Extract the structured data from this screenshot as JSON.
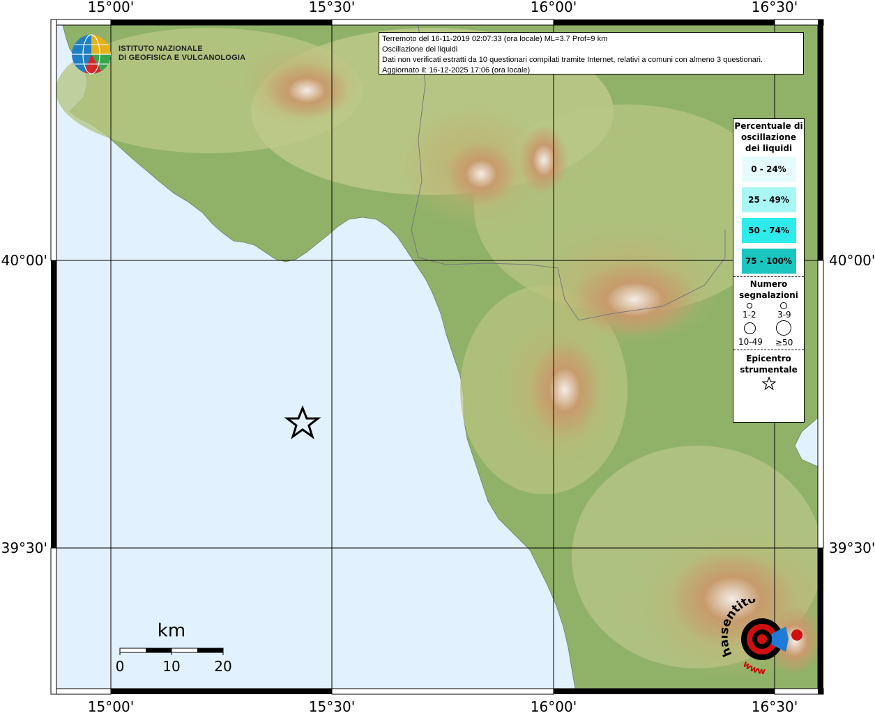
{
  "title_box": {
    "line1": "Terremoto del 16-11-2019 02:07:33 (ora locale) ML=3.7 Prof=9 km",
    "line2": "Oscillazione dei liquidi",
    "line3": "Dati non verificati estratti da 10 questionari compilati tramite Internet, relativi a comuni con almeno 3 questionari.",
    "line4": "Aggiornato il: 16-12-2025 17:06 (ora locale)"
  },
  "logo": {
    "line1": "ISTITUTO NAZIONALE",
    "line2": "DI GEOFISICA E VULCANOLOGIA"
  },
  "axes": {
    "top": [
      "15°00'",
      "15°30'",
      "16°00'",
      "16°30'"
    ],
    "bottom": [
      "15°00'",
      "15°30'",
      "16°00'",
      "16°30'"
    ],
    "left": [
      "40°00'",
      "39°30'"
    ],
    "right": [
      "40°00'",
      "39°30'"
    ]
  },
  "legend": {
    "pct_title": "Percentuale di oscillazione dei liquidi",
    "pct_items": [
      {
        "label": "0 - 24%",
        "color": "#e6fcfc"
      },
      {
        "label": "25 - 49%",
        "color": "#a8f7f5"
      },
      {
        "label": "50 - 74%",
        "color": "#2fecec"
      },
      {
        "label": "75 - 100%",
        "color": "#1bc6c1"
      }
    ],
    "count_title": "Numero segnalazioni",
    "count_items": [
      "1-2",
      "3-9",
      "10-49",
      "≥50"
    ],
    "epi_title": "Epicentro strumentale"
  },
  "scale_bar": {
    "unit": "km",
    "labels": [
      "0",
      "10",
      "20"
    ]
  },
  "hsit_logo": {
    "text": "haisentitoilterremoto.it www"
  },
  "colors": {
    "sea": "#e1f1fd",
    "grid": "#000000",
    "lowland": "#7aa85a",
    "hill": "#b9c886",
    "mountain": "#c9a26b",
    "peak": "#efe6df"
  }
}
